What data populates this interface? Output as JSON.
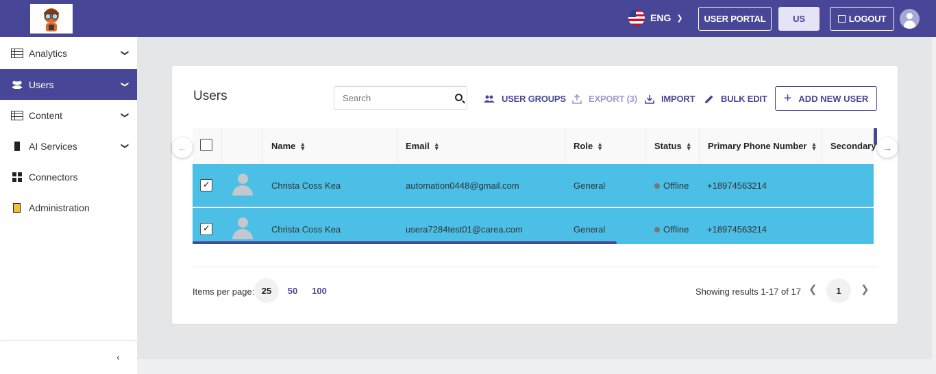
{
  "header": {
    "language": "ENG",
    "user_portal": "USER PORTAL",
    "region": "US",
    "logout": "LOGOUT"
  },
  "sidebar": {
    "items": [
      {
        "label": "Analytics"
      },
      {
        "label": "Users"
      },
      {
        "label": "Content"
      },
      {
        "label": "AI Services"
      },
      {
        "label": "Connectors"
      },
      {
        "label": "Administration"
      }
    ],
    "collapse_icon": "chevron-left-icon"
  },
  "users": {
    "title": "Users",
    "search_placeholder": "Search",
    "actions": {
      "user_groups": "USER GROUPS",
      "export": "EXPORT (3)",
      "import": "IMPORT",
      "bulk_edit": "BULK EDIT",
      "add_new_user": "ADD NEW USER"
    },
    "columns": [
      "Name",
      "Email",
      "Role",
      "Status",
      "Primary Phone Number",
      "Secondary"
    ],
    "rows": [
      {
        "name": "Christa Coss Kea",
        "email": "automation0448@gmail.com",
        "role": "General",
        "status": "Offline",
        "phone": "+18974563214",
        "selected": true
      },
      {
        "name": "Christa Coss Kea",
        "email": "usera7284test01@carea.com",
        "role": "General",
        "status": "Offline",
        "phone": "+18974563214",
        "selected": true
      }
    ]
  },
  "pagination": {
    "items_per_page_label": "Items per page:",
    "options": [
      "25",
      "50",
      "100"
    ],
    "selected_option": "25",
    "showing": "Showing results 1-17 of 17",
    "current_page": "1"
  },
  "colors": {
    "brand": "#484696",
    "selected_row": "#4bbfe6",
    "scroll_arrow": "#2a9fd6"
  }
}
